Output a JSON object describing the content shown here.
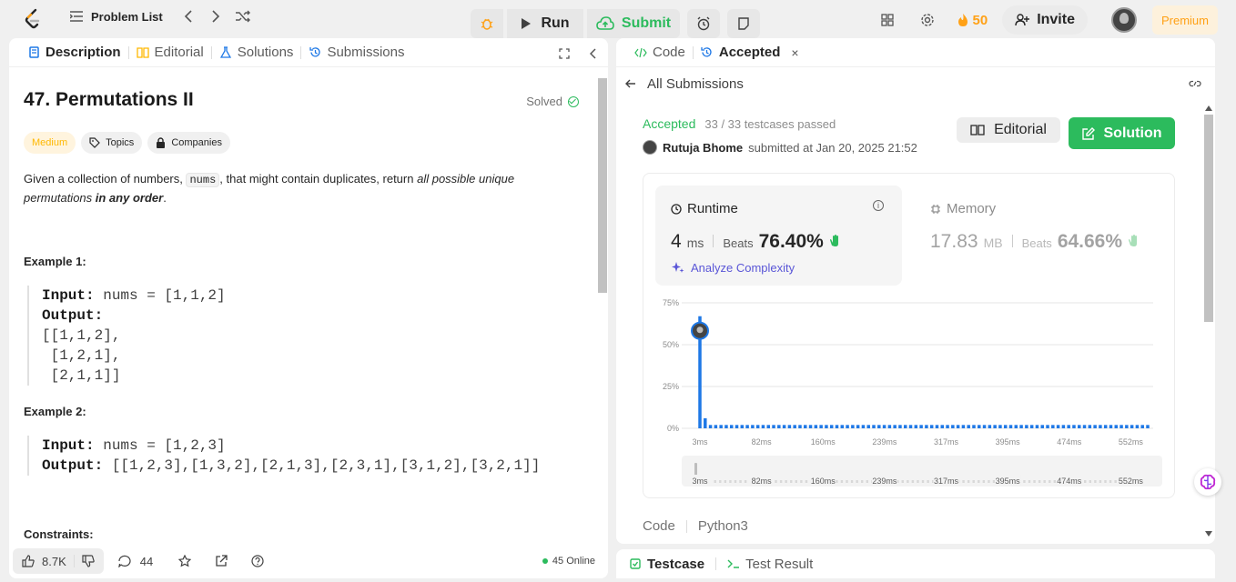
{
  "nav": {
    "problem_list": "Problem List",
    "run": "Run",
    "submit": "Submit",
    "streak": "50",
    "invite": "Invite",
    "premium": "Premium"
  },
  "left_tabs": [
    {
      "label": "Description",
      "icon": "document-icon"
    },
    {
      "label": "Editorial",
      "icon": "book-icon"
    },
    {
      "label": "Solutions",
      "icon": "flask-icon"
    },
    {
      "label": "Submissions",
      "icon": "history-icon"
    }
  ],
  "problem": {
    "title": "47. Permutations II",
    "solved": "Solved",
    "difficulty": "Medium",
    "topics": "Topics",
    "companies": "Companies",
    "desc_pre": "Given a collection of numbers, ",
    "desc_code": "nums",
    "desc_mid": ", that might contain duplicates, return ",
    "desc_em": "all possible unique permutations",
    "desc_bold": " in any order",
    "desc_end": ".",
    "example1_title": "Example 1:",
    "example1_input_label": "Input:",
    "example1_input": " nums = [1,1,2]",
    "example1_output_label": "Output:",
    "example1_output": "[[1,1,2],\n [1,2,1],\n [2,1,1]]",
    "example2_title": "Example 2:",
    "example2_input_label": "Input:",
    "example2_input": " nums = [1,2,3]",
    "example2_output_label": "Output:",
    "example2_output": " [[1,2,3],[1,3,2],[2,1,3],[2,3,1],[3,1,2],[3,2,1]]",
    "constraints": "Constraints:"
  },
  "left_footer": {
    "likes": "8.7K",
    "comments": "44",
    "online": "45 Online"
  },
  "right_tabs": {
    "code": "Code",
    "accepted": "Accepted",
    "all_submissions": "All Submissions"
  },
  "submission": {
    "status": "Accepted",
    "testcases": "33 / 33 testcases passed",
    "user": "Rutuja Bhome",
    "submitted_at": "submitted at Jan 20, 2025 21:52",
    "editorial": "Editorial",
    "solution": "Solution"
  },
  "runtime": {
    "label": "Runtime",
    "value": "4",
    "unit": "ms",
    "beats_label": "Beats",
    "beats": "76.40%",
    "analyze": "Analyze Complexity"
  },
  "memory": {
    "label": "Memory",
    "value": "17.83",
    "unit": "MB",
    "beats_label": "Beats",
    "beats": "64.66%"
  },
  "chart_data": {
    "type": "bar",
    "y_ticks": [
      "75%",
      "50%",
      "25%",
      "0%"
    ],
    "ylim": [
      0,
      75
    ],
    "x_ticks": [
      "3ms",
      "82ms",
      "160ms",
      "239ms",
      "317ms",
      "395ms",
      "474ms",
      "552ms"
    ],
    "values": [
      67,
      6,
      2,
      2,
      2,
      2,
      2,
      2,
      2,
      2,
      2,
      2,
      2,
      2,
      2,
      2,
      2,
      2,
      2,
      2,
      2,
      2,
      2,
      2,
      2,
      2,
      2,
      2,
      2,
      2,
      2,
      2,
      2,
      2,
      2,
      2,
      2,
      2,
      2,
      2,
      2,
      2,
      2,
      2,
      2,
      2,
      2,
      2,
      2,
      2,
      2,
      2,
      2,
      2,
      2,
      2,
      2,
      2,
      2,
      2,
      2,
      2,
      2,
      2,
      2,
      2,
      2,
      2,
      2,
      2,
      2,
      2,
      2,
      2,
      2,
      2,
      2,
      2,
      2,
      2,
      2,
      2,
      2,
      2,
      2,
      2
    ],
    "highlight_index": 0,
    "bar_color": "#1e78e6",
    "grid": true
  },
  "code_section": {
    "label": "Code",
    "language": "Python3"
  },
  "bottom_tabs": {
    "testcase": "Testcase",
    "test_result": "Test Result"
  },
  "colors": {
    "accent_green": "#2cbb5d",
    "brand_orange": "#ffa116",
    "medium": "#ffb800",
    "analyze": "#5a56d7"
  }
}
